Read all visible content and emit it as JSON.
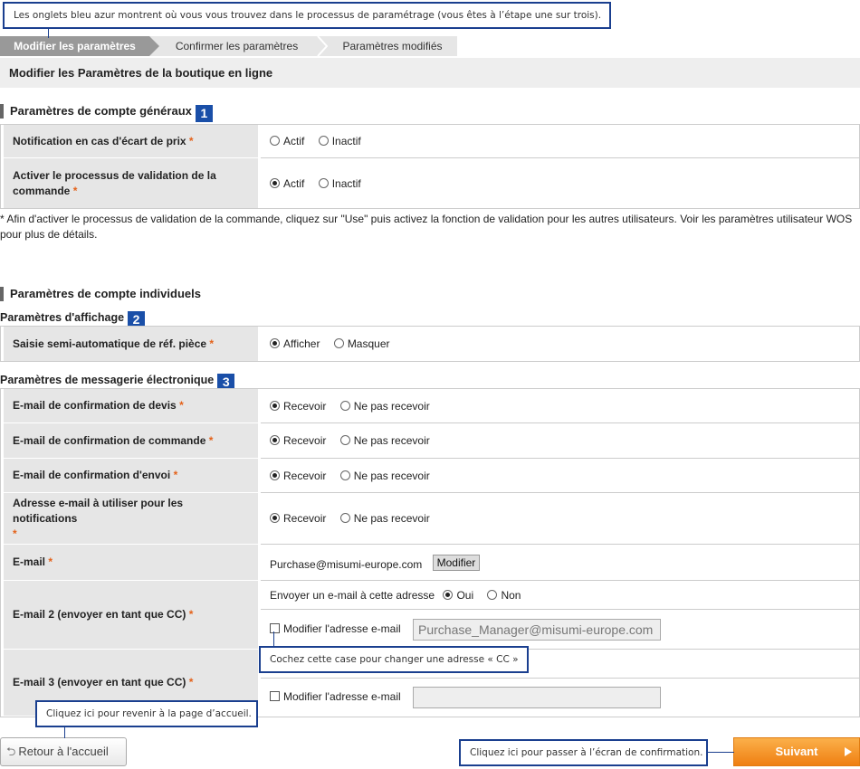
{
  "callouts": {
    "tabs": "Les onglets bleu azur montrent où vous vous trouvez dans le processus de paramétrage (vous êtes à l’étape une sur trois).",
    "cc": "Cochez cette case pour changer une adresse « CC »",
    "home": "Cliquez ici pour revenir à la page d’accueil.",
    "confirm": "Cliquez ici pour passer à l’écran de confirmation."
  },
  "steps": [
    "Modifier les paramètres",
    "Confirmer les paramètres",
    "Paramètres modifiés"
  ],
  "page_title": "Modifier les Paramètres de la boutique en ligne",
  "section1": {
    "title": "Paramètres de compte généraux",
    "badge": "1",
    "rows": [
      {
        "label": "Notification en cas d'écart de prix",
        "opt1": "Actif",
        "opt2": "Inactif",
        "selected": "none"
      },
      {
        "label": "Activer le processus de validation de la commande",
        "opt1": "Actif",
        "opt2": "Inactif",
        "selected": "opt1"
      }
    ],
    "note": "* Afin d'activer le processus de validation de la commande, cliquez sur \"Use\" puis activez la fonction de validation pour les autres utilisateurs. Voir les paramètres utilisateur WOS pour plus de détails."
  },
  "section2": {
    "title": "Paramètres de compte individuels",
    "display": {
      "title": "Paramètres d'affichage",
      "badge": "2",
      "label": "Saisie semi-automatique de réf. pièce",
      "opt1": "Afficher",
      "opt2": "Masquer"
    },
    "email": {
      "title": "Paramètres de messagerie électronique",
      "badge": "3",
      "rows": [
        {
          "label": "E-mail de confirmation de devis",
          "opt1": "Recevoir",
          "opt2": "Ne pas recevoir"
        },
        {
          "label": "E-mail de confirmation de commande",
          "opt1": "Recevoir",
          "opt2": "Ne pas recevoir"
        },
        {
          "label": "E-mail de confirmation d'envoi",
          "opt1": "Recevoir",
          "opt2": "Ne pas recevoir"
        },
        {
          "label": "Adresse e-mail à utiliser pour les notifications",
          "opt1": "Recevoir",
          "opt2": "Ne pas recevoir"
        }
      ],
      "email_label": "E-mail",
      "email_value": "Purchase@misumi-europe.com",
      "modify_button": "Modifier",
      "email2_label": "E-mail 2 (envoyer en tant que CC)",
      "send_to_label": "Envoyer un e-mail à cette adresse",
      "yes": "Oui",
      "no": "Non",
      "modify_address": "Modifier l'adresse e-mail",
      "email2_value": "Purchase_Manager@misumi-europe.com",
      "email3_label": "E-mail 3 (envoyer en tant que CC)",
      "email3_value": ""
    }
  },
  "required_mark": "*",
  "buttons": {
    "back": "Retour à l'accueil",
    "next": "Suivant"
  }
}
